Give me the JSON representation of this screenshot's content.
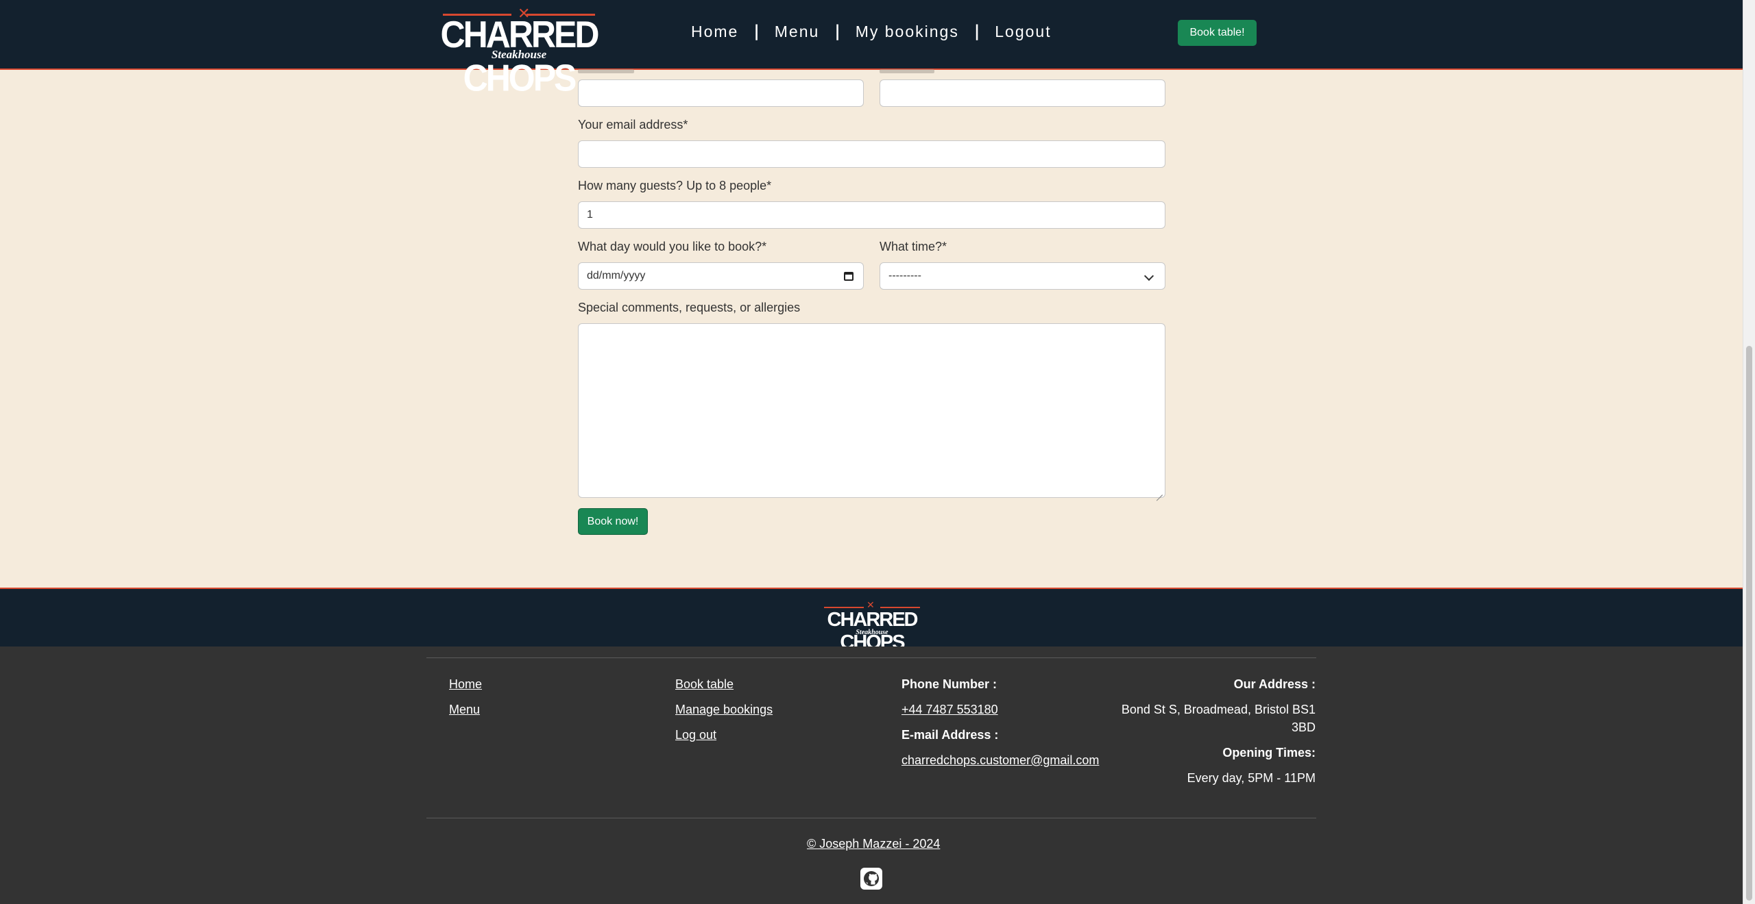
{
  "navbar": {
    "logo_title": "CHARRED CHOPS",
    "logo_subtitle": "Steakhouse",
    "links": [
      "Home",
      "Menu",
      "My bookings",
      "Logout"
    ],
    "separator": "|",
    "book_button": "Book table!"
  },
  "form": {
    "email_label": "Your email address*",
    "guests_label": "How many guests? Up to 8 people*",
    "guests_value": "1",
    "date_label": "What day would you like to book?*",
    "date_placeholder": "dd/mm/yyyy",
    "time_label": "What time?*",
    "time_selected": "---------",
    "comments_label": "Special comments, requests, or allergies",
    "submit_button": "Book now!"
  },
  "footer": {
    "logo_title": "CHARRED CHOPS",
    "logo_subtitle": "Steakhouse",
    "col1": [
      "Home",
      "Menu"
    ],
    "col2": [
      "Book table",
      "Manage bookings",
      "Log out"
    ],
    "phone_heading": "Phone Number :",
    "phone": "+44 7487 553180",
    "email_heading": "E-mail Address :",
    "email": "charredchops.customer@gmail.com",
    "address_heading": "Our Address :",
    "address_line1": "Bond St S, Broadmead, Bristol BS1",
    "address_line2": "3BD",
    "hours_heading": "Opening Times:",
    "hours": "Every day, 5PM - 11PM",
    "copyright": "© Joseph Mazzei - 2024",
    "github_icon": "github-icon"
  },
  "colors": {
    "navy": "#13212e",
    "accent_red": "#d8482f",
    "cream": "#f5ebdc",
    "green": "#198754",
    "footer_grey": "#333333"
  }
}
